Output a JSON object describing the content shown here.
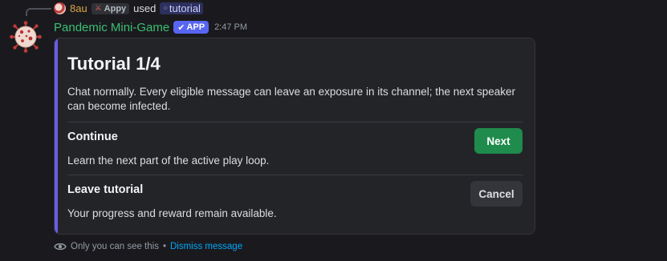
{
  "reply": {
    "username": "8au",
    "tag_label": "Appy",
    "used_text": "used",
    "command": "tutorial"
  },
  "message": {
    "author": "Pandemic Mini-Game",
    "badge": "APP",
    "timestamp": "2:47 PM"
  },
  "embed": {
    "title": "Tutorial 1/4",
    "description": "Chat normally. Every eligible message can leave an exposure in its channel; the next speaker can become infected.",
    "sections": [
      {
        "title": "Continue",
        "description": "Learn the next part of the active play loop.",
        "button": "Next"
      },
      {
        "title": "Leave tutorial",
        "description": "Your progress and reward remain available.",
        "button": "Cancel"
      }
    ]
  },
  "footer": {
    "note": "Only you can see this",
    "separator": "•",
    "dismiss": "Dismiss message"
  },
  "colors": {
    "author_name": "#3bbf72",
    "app_badge": "#5865f2",
    "embed_accent": "#6c5ce7",
    "next_button": "#1f8b4c",
    "link": "#00a8fc"
  },
  "icons": {
    "reply_avatar": "virus-avatar",
    "bot_avatar": "virus-avatar",
    "tag_icon": "sword-icon",
    "command_icon": "slash-command-icon",
    "badge_icon": "checkmark-icon",
    "footer_icon": "eye-icon"
  }
}
